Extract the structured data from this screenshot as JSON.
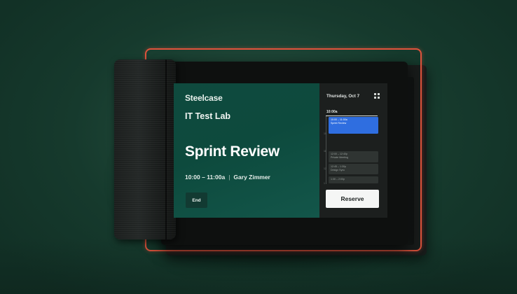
{
  "device": {
    "brand": "Steelcase",
    "room_name": "IT Test Lab"
  },
  "meeting": {
    "title": "Sprint Review",
    "time": "10:00 – 11:00a",
    "separator": "|",
    "organizer": "Gary Zimmer",
    "end_label": "End"
  },
  "schedule": {
    "date": "Thursday, Oct 7",
    "current_time": "10:00a",
    "view_icon": "grid-icon",
    "hour_ticks": [
      "10",
      "11",
      "12",
      "1"
    ],
    "events": [
      {
        "time": "10:00 – 11:00a",
        "name": "Sprint Review",
        "active": true
      },
      {
        "time": "12:00 – 12:40p",
        "name": "Private Meeting",
        "active": false
      },
      {
        "time": "12:45 – 1:30p",
        "name": "Design Sync",
        "active": false
      },
      {
        "time": "1:30 – 2:00p",
        "name": "",
        "active": false
      }
    ],
    "reserve_label": "Reserve"
  },
  "colors": {
    "accent_blue": "#2f6ee0",
    "panel_green": "#0f4a3e",
    "frame_red": "#e0533c"
  }
}
